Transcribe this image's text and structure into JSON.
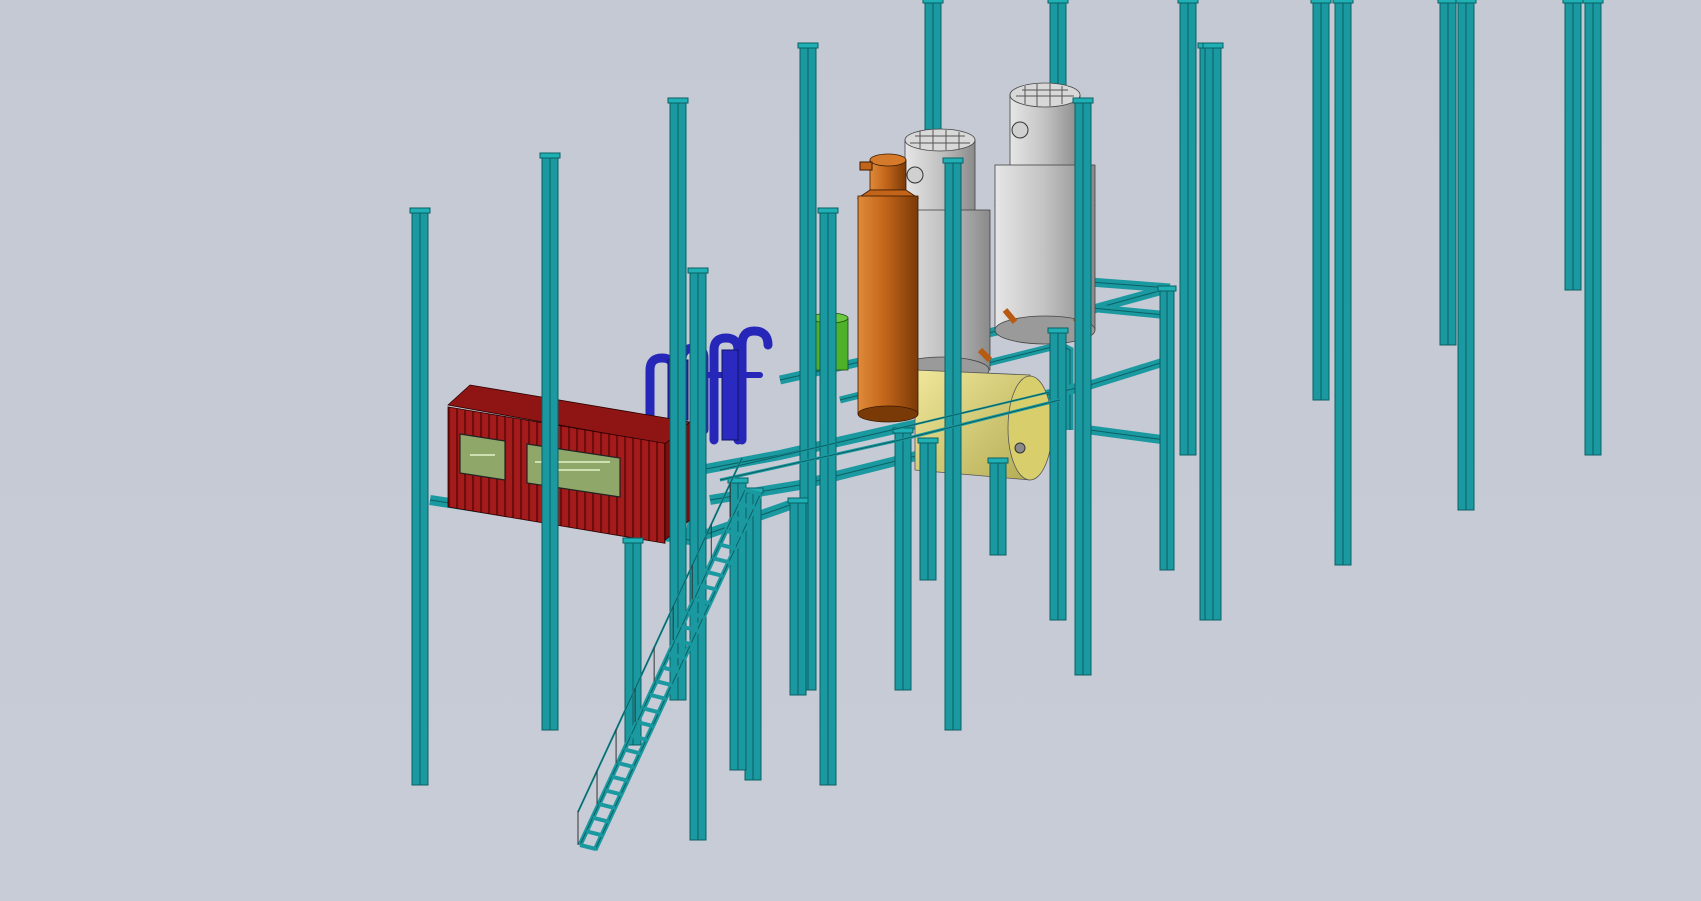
{
  "viewport": {
    "background": "#c6cad5",
    "view_mode": "isometric-shaded-with-edges"
  },
  "colors": {
    "steel_structure": "#1a9aa0",
    "steel_dark": "#0b5f63",
    "control_container": "#a01818",
    "container_window": "#8fa86a",
    "stack_column": "#b85a12",
    "tank_grey": "#b9b9b9",
    "horizontal_vessel": "#d8d07a",
    "piping_blue": "#2a2ac0",
    "filter_green": "#4fb02a",
    "stair_steel": "#1a9aa0"
  },
  "model": {
    "components": [
      "steel-frame-structure",
      "control-room-container",
      "orange-column-stack",
      "grey-tank-1",
      "grey-tank-2",
      "horizontal-vessel",
      "blue-piping-bundle",
      "green-filter",
      "access-staircase"
    ]
  }
}
